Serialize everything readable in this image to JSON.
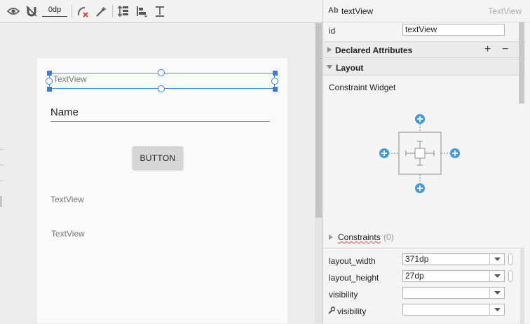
{
  "toolbar": {
    "margin_value": "0dp",
    "icons": [
      "eye-icon",
      "magnet-icon",
      "clear-constraints-icon",
      "infer-constraints-icon",
      "pack-icon",
      "align-icon",
      "guidelines-icon"
    ]
  },
  "canvas": {
    "selected_view_text": "TextView",
    "edit_text_value": "Name",
    "button_text": "BUTTON",
    "textview_2": "TextView",
    "textview_3": "TextView"
  },
  "attributes": {
    "header_icon_text": "Ab",
    "component_name": "textView",
    "component_type": "TextView",
    "id_label": "id",
    "id_value": "textView",
    "declared_attributes_title": "Declared Attributes",
    "add_symbol": "+",
    "remove_symbol": "−",
    "layout_title": "Layout",
    "constraint_widget_label": "Constraint Widget",
    "constraints_label": "Constraints",
    "constraints_count": "(0)",
    "layout_width_label": "layout_width",
    "layout_width_value": "371dp",
    "layout_height_label": "layout_height",
    "layout_height_value": "27dp",
    "visibility_label": "visibility",
    "tools_visibility_label": "visibility",
    "visibility_value": "",
    "tools_visibility_value": ""
  },
  "colors": {
    "accent_blue": "#2f7ee6",
    "constraint_add_blue": "#3b9be0"
  }
}
